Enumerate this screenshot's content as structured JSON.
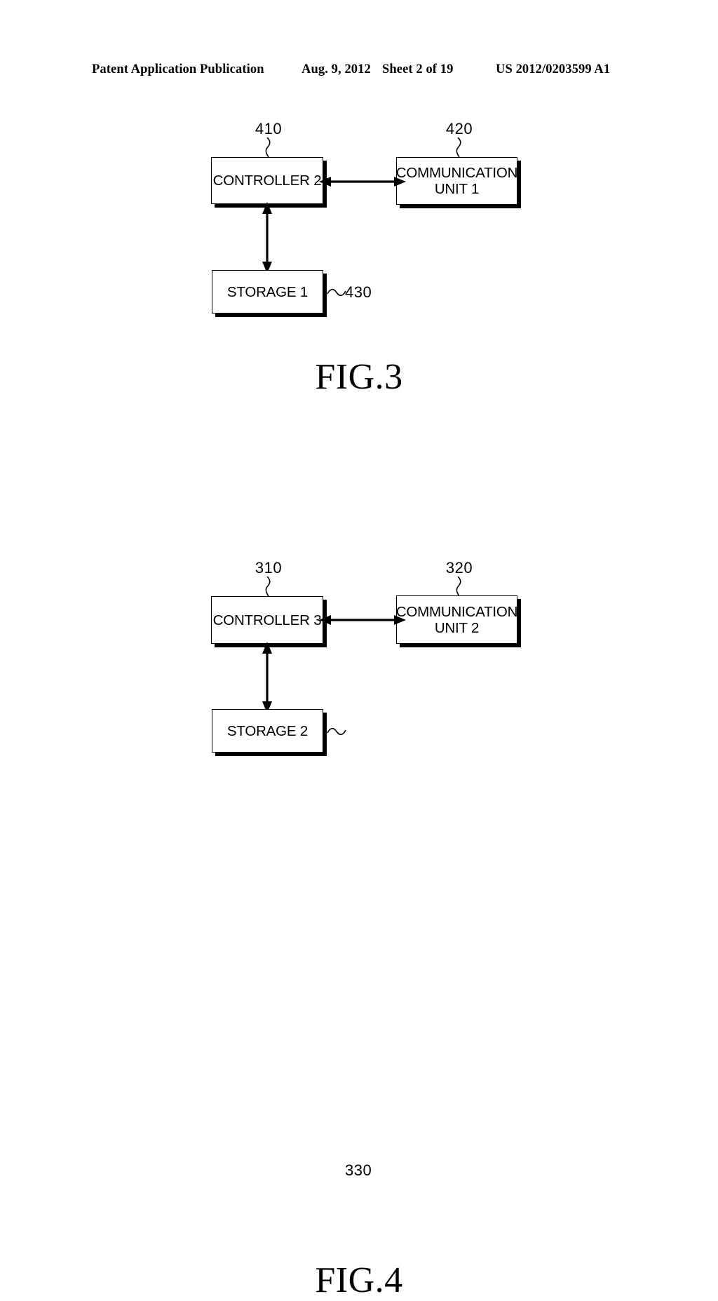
{
  "header": {
    "publication": "Patent Application Publication",
    "date": "Aug. 9, 2012",
    "sheet": "Sheet 2 of 19",
    "document_number": "US 2012/0203599 A1"
  },
  "figures": [
    {
      "id": "fig3",
      "caption": "FIG.3",
      "nodes": [
        {
          "id": "controller-2",
          "label": "CONTROLLER 2",
          "ref": "410"
        },
        {
          "id": "communication-1",
          "label": "COMMUNICATION\nUNIT 1",
          "ref": "420"
        },
        {
          "id": "storage-1",
          "label": "STORAGE 1",
          "ref": "430"
        }
      ],
      "connectors": [
        {
          "id": "controller-2-to-communication-1",
          "orientation": "horizontal",
          "arrowheads": "both"
        },
        {
          "id": "controller-2-to-storage-1",
          "orientation": "vertical",
          "arrowheads": "both"
        }
      ]
    },
    {
      "id": "fig4",
      "caption": "FIG.4",
      "nodes": [
        {
          "id": "controller-3",
          "label": "CONTROLLER 3",
          "ref": "310"
        },
        {
          "id": "communication-2",
          "label": "COMMUNICATION\nUNIT 2",
          "ref": "320"
        },
        {
          "id": "storage-2",
          "label": "STORAGE 2",
          "ref": "330"
        }
      ],
      "connectors": [
        {
          "id": "controller-3-to-communication-2",
          "orientation": "horizontal",
          "arrowheads": "both"
        },
        {
          "id": "controller-3-to-storage-2",
          "orientation": "vertical",
          "arrowheads": "both"
        }
      ]
    }
  ],
  "colors": {
    "ink": "#000000",
    "paper": "#ffffff"
  }
}
